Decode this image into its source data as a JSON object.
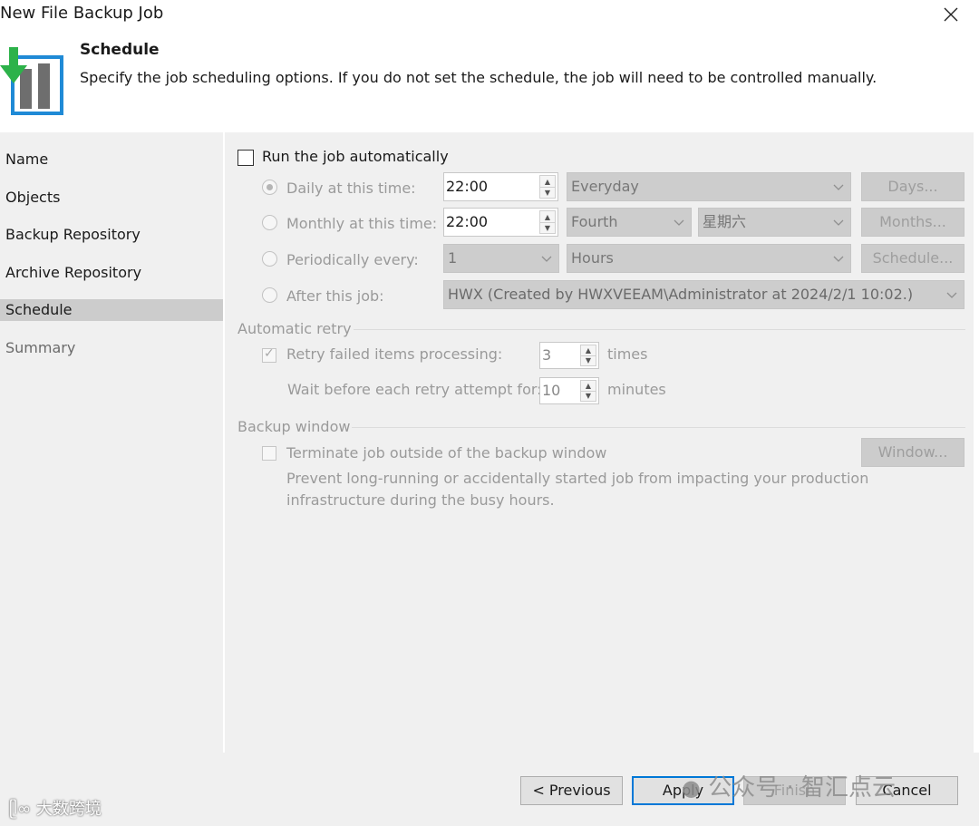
{
  "window": {
    "title": "New File Backup Job",
    "close_icon": "close-icon"
  },
  "header": {
    "title": "Schedule",
    "description": "Specify the job scheduling options. If you do not set the schedule, the job will need to be controlled manually.",
    "icon": "schedule-backup-icon"
  },
  "sidebar": {
    "items": [
      {
        "label": "Name"
      },
      {
        "label": "Objects"
      },
      {
        "label": "Backup Repository"
      },
      {
        "label": "Archive Repository"
      },
      {
        "label": "Schedule",
        "active": true
      },
      {
        "label": "Summary"
      }
    ]
  },
  "schedule": {
    "run_auto_label": "Run the job automatically",
    "run_auto_checked": false,
    "daily": {
      "label": "Daily at this time:",
      "time": "22:00",
      "option": "Everyday",
      "button": "Days...",
      "selected": true
    },
    "monthly": {
      "label": "Monthly at this time:",
      "time": "22:00",
      "week": "Fourth",
      "day": "星期六",
      "button": "Months..."
    },
    "periodic": {
      "label": "Periodically every:",
      "value": "1",
      "unit": "Hours",
      "button": "Schedule..."
    },
    "after": {
      "label": "After this job:",
      "job": "HWX (Created by HWXVEEAM\\Administrator at 2024/2/1 10:02.)"
    }
  },
  "retry": {
    "section_label": "Automatic retry",
    "retry_label": "Retry failed items processing:",
    "retry_checked": true,
    "retry_count": "3",
    "retry_unit": "times",
    "wait_label": "Wait before each retry attempt for:",
    "wait_value": "10",
    "wait_unit": "minutes"
  },
  "backup_window": {
    "section_label": "Backup window",
    "terminate_label": "Terminate job outside of the backup window",
    "terminate_checked": false,
    "button": "Window...",
    "desc_line1": "Prevent long-running or accidentally started job from impacting your production",
    "desc_line2": "infrastructure during the busy hours."
  },
  "footer": {
    "previous": "< Previous",
    "apply": "Apply",
    "finish": "Finish",
    "cancel": "Cancel"
  },
  "watermarks": {
    "wechat": "公众号 · 智汇点云",
    "bottom_left": "大数跨境"
  },
  "colors": {
    "accent": "#0078d7",
    "panel_bg": "#f0f0f0",
    "selected_nav": "#cccccc",
    "icon_green": "#2db24a",
    "icon_blue": "#1f8ad6"
  }
}
